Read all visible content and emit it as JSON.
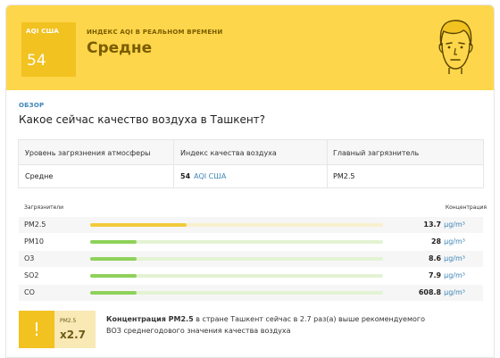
{
  "header": {
    "aqi_label": "AQI США",
    "aqi_value": "54",
    "subtitle": "ИНДЕКС AQI В РЕАЛЬНОМ ВРЕМЕНИ",
    "status": "Средне"
  },
  "overview": {
    "tag": "ОБЗОР",
    "question": "Какое сейчас качество воздуха в Ташкент?",
    "table": {
      "headers": [
        "Уровень загрязнения атмосферы",
        "Индекс качества воздуха",
        "Главный загрязнитель"
      ],
      "level": "Средне",
      "index_value": "54",
      "index_unit": "AQI США",
      "main_pollutant": "PM2.5"
    }
  },
  "pollutants": {
    "header_left": "Загрязнители",
    "header_right": "Концентрация",
    "rows": [
      {
        "name": "PM2.5",
        "value": "13.7",
        "unit": "µg/m³",
        "level": 0.33,
        "color": "#f2cb3c"
      },
      {
        "name": "PM10",
        "value": "28",
        "unit": "µg/m³",
        "level": 0.16,
        "color": "#8fd15a"
      },
      {
        "name": "O3",
        "value": "8.6",
        "unit": "µg/m³",
        "level": 0.16,
        "color": "#8fd15a"
      },
      {
        "name": "SO2",
        "value": "7.9",
        "unit": "µg/m³",
        "level": 0.16,
        "color": "#8fd15a"
      },
      {
        "name": "CO",
        "value": "608.8",
        "unit": "µg/m³",
        "level": 0.16,
        "color": "#8fd15a"
      }
    ]
  },
  "recommendation": {
    "badge_icon": "!",
    "badge_label": "PM2.5",
    "badge_value": "x2.7",
    "text_bold": "Концентрация PM2.5",
    "text_rest": " в стране Ташкент сейчас в 2.7 раз(а) выше рекомендуемого ВОЗ среднегодового значения качества воздуха"
  },
  "colors": {
    "header_bg": "#fdd64b",
    "aqi_box": "#f2c220",
    "link": "#3d86b8"
  },
  "icons": {
    "face": "neutral-face-icon",
    "warning": "exclamation-icon"
  }
}
